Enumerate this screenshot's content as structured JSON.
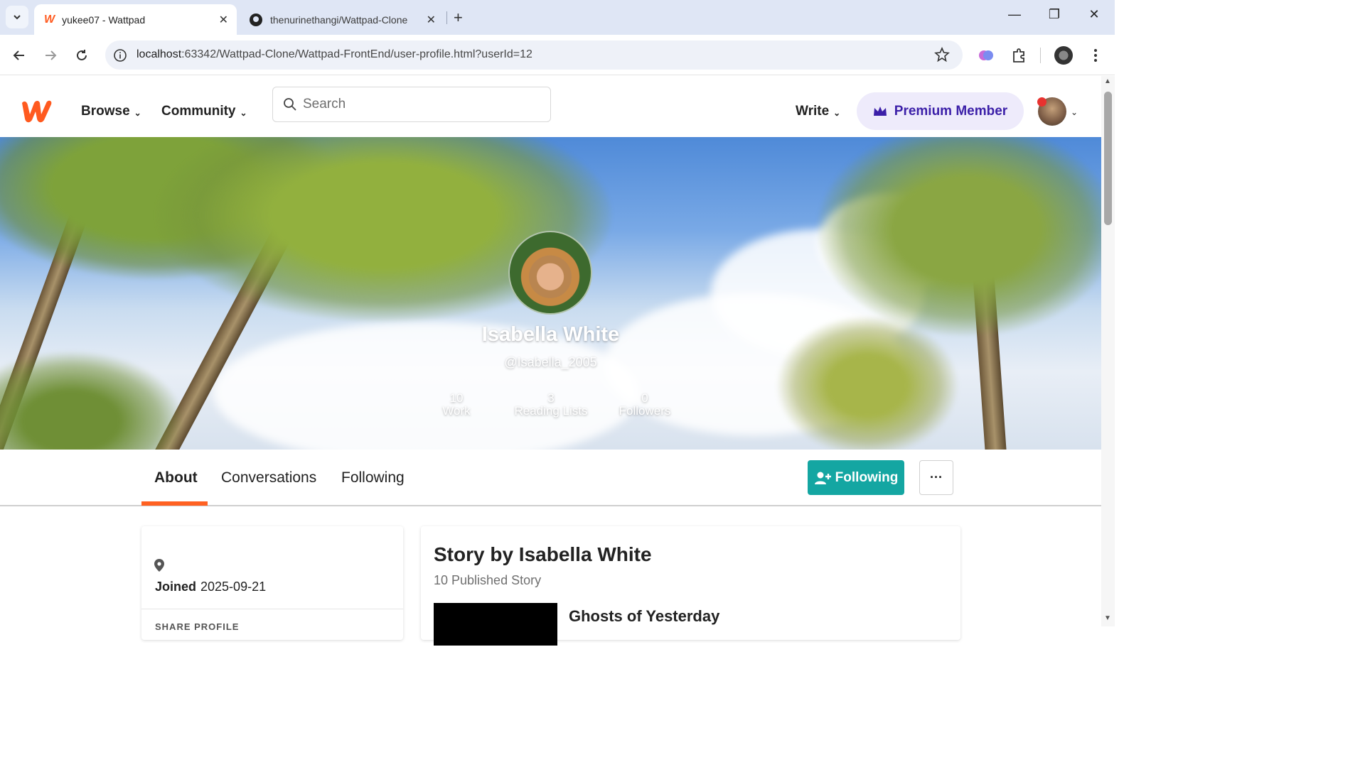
{
  "browser": {
    "tabs": [
      {
        "title": "yukee07 - Wattpad",
        "active": true
      },
      {
        "title": "thenurinethangi/Wattpad-Clone",
        "active": false
      }
    ],
    "url_host": "localhost",
    "url_path": ":63342/Wattpad-Clone/Wattpad-FrontEnd/user-profile.html?userId=12"
  },
  "header": {
    "nav": [
      {
        "label": "Browse"
      },
      {
        "label": "Community"
      }
    ],
    "search_placeholder": "Search",
    "write_label": "Write",
    "premium_label": "Premium Member"
  },
  "profile": {
    "name": "Isabella White",
    "handle": "@Isabella_2005",
    "stats": [
      {
        "value": "10",
        "label": "Work"
      },
      {
        "value": "3",
        "label": "Reading Lists"
      },
      {
        "value": "0",
        "label": "Followers"
      }
    ]
  },
  "tabs": [
    {
      "label": "About"
    },
    {
      "label": "Conversations"
    },
    {
      "label": "Following"
    }
  ],
  "actions": {
    "following_label": "Following",
    "more_label": "···"
  },
  "about": {
    "joined_label": "Joined",
    "joined_date": "2025-09-21",
    "share_label": "SHARE PROFILE"
  },
  "stories": {
    "title": "Story by Isabella White",
    "count_text": "10 Published Story",
    "items": [
      {
        "title": "Ghosts of Yesterday"
      }
    ]
  },
  "colors": {
    "accent": "#ff6122",
    "teal": "#14a6a2",
    "premium": "#3b1fa8"
  }
}
